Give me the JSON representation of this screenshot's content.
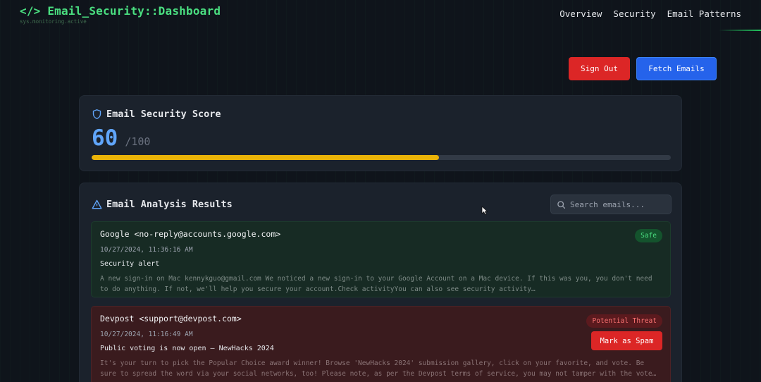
{
  "header": {
    "title": "</> Email_Security::Dashboard",
    "subtitle": "sys.monitoring.active",
    "nav": [
      "Overview",
      "Security",
      "Email Patterns"
    ]
  },
  "actions": {
    "sign_out": "Sign Out",
    "fetch_emails": "Fetch Emails"
  },
  "score": {
    "title": "Email Security Score",
    "value": "60",
    "max": "/100",
    "progress": 0.6
  },
  "results": {
    "title": "Email Analysis Results",
    "search_placeholder": "Search emails...",
    "emails": [
      {
        "sender": "Google <no-reply@accounts.google.com>",
        "date": "10/27/2024, 11:36:16 AM",
        "subject": "Security alert",
        "preview": "A new sign-in on Mac kennykguo@gmail.com We noticed a new sign-in to your Google Account on a Mac device. If this was you, you don't need to do anything. If not, we'll help you secure your account.Check activityYou can also see security activity…",
        "status": "Safe"
      },
      {
        "sender": "Devpost <support@devpost.com>",
        "date": "10/27/2024, 11:16:49 AM",
        "subject": "Public voting is now open – NewHacks 2024",
        "preview": "It's your turn to pick the Popular Choice award winner! Browse 'NewHacks 2024' submission gallery, click on your favorite, and vote. Be sure to spread the word via your social networks, too! Please note, as per the Devpost terms of service, you may not tamper with the vote…",
        "status": "Potential Threat",
        "action": "Mark as Spam"
      }
    ]
  },
  "colors": {
    "brand": "#4ade80",
    "score": "#60a5fa",
    "progress": "#eab308",
    "danger": "#dc2626",
    "primary": "#2563eb"
  },
  "icons": [
    "shield-icon",
    "warning-triangle-icon",
    "search-icon",
    "mouse-cursor-icon"
  ]
}
